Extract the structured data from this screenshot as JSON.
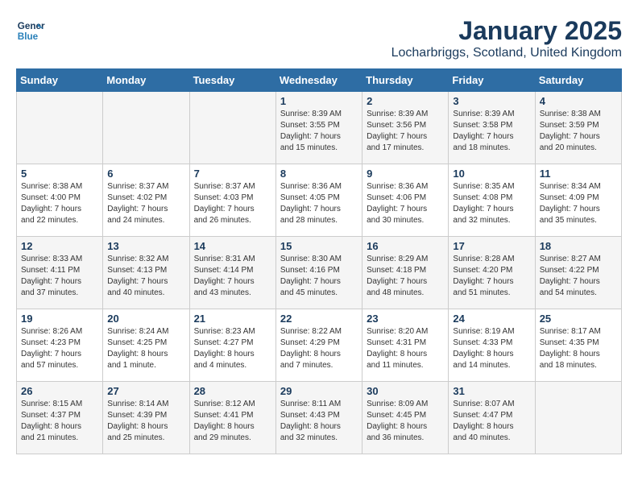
{
  "logo": {
    "line1": "General",
    "line2": "Blue"
  },
  "title": "January 2025",
  "location": "Locharbriggs, Scotland, United Kingdom",
  "weekdays": [
    "Sunday",
    "Monday",
    "Tuesday",
    "Wednesday",
    "Thursday",
    "Friday",
    "Saturday"
  ],
  "weeks": [
    [
      {
        "day": "",
        "lines": []
      },
      {
        "day": "",
        "lines": []
      },
      {
        "day": "",
        "lines": []
      },
      {
        "day": "1",
        "lines": [
          "Sunrise: 8:39 AM",
          "Sunset: 3:55 PM",
          "Daylight: 7 hours",
          "and 15 minutes."
        ]
      },
      {
        "day": "2",
        "lines": [
          "Sunrise: 8:39 AM",
          "Sunset: 3:56 PM",
          "Daylight: 7 hours",
          "and 17 minutes."
        ]
      },
      {
        "day": "3",
        "lines": [
          "Sunrise: 8:39 AM",
          "Sunset: 3:58 PM",
          "Daylight: 7 hours",
          "and 18 minutes."
        ]
      },
      {
        "day": "4",
        "lines": [
          "Sunrise: 8:38 AM",
          "Sunset: 3:59 PM",
          "Daylight: 7 hours",
          "and 20 minutes."
        ]
      }
    ],
    [
      {
        "day": "5",
        "lines": [
          "Sunrise: 8:38 AM",
          "Sunset: 4:00 PM",
          "Daylight: 7 hours",
          "and 22 minutes."
        ]
      },
      {
        "day": "6",
        "lines": [
          "Sunrise: 8:37 AM",
          "Sunset: 4:02 PM",
          "Daylight: 7 hours",
          "and 24 minutes."
        ]
      },
      {
        "day": "7",
        "lines": [
          "Sunrise: 8:37 AM",
          "Sunset: 4:03 PM",
          "Daylight: 7 hours",
          "and 26 minutes."
        ]
      },
      {
        "day": "8",
        "lines": [
          "Sunrise: 8:36 AM",
          "Sunset: 4:05 PM",
          "Daylight: 7 hours",
          "and 28 minutes."
        ]
      },
      {
        "day": "9",
        "lines": [
          "Sunrise: 8:36 AM",
          "Sunset: 4:06 PM",
          "Daylight: 7 hours",
          "and 30 minutes."
        ]
      },
      {
        "day": "10",
        "lines": [
          "Sunrise: 8:35 AM",
          "Sunset: 4:08 PM",
          "Daylight: 7 hours",
          "and 32 minutes."
        ]
      },
      {
        "day": "11",
        "lines": [
          "Sunrise: 8:34 AM",
          "Sunset: 4:09 PM",
          "Daylight: 7 hours",
          "and 35 minutes."
        ]
      }
    ],
    [
      {
        "day": "12",
        "lines": [
          "Sunrise: 8:33 AM",
          "Sunset: 4:11 PM",
          "Daylight: 7 hours",
          "and 37 minutes."
        ]
      },
      {
        "day": "13",
        "lines": [
          "Sunrise: 8:32 AM",
          "Sunset: 4:13 PM",
          "Daylight: 7 hours",
          "and 40 minutes."
        ]
      },
      {
        "day": "14",
        "lines": [
          "Sunrise: 8:31 AM",
          "Sunset: 4:14 PM",
          "Daylight: 7 hours",
          "and 43 minutes."
        ]
      },
      {
        "day": "15",
        "lines": [
          "Sunrise: 8:30 AM",
          "Sunset: 4:16 PM",
          "Daylight: 7 hours",
          "and 45 minutes."
        ]
      },
      {
        "day": "16",
        "lines": [
          "Sunrise: 8:29 AM",
          "Sunset: 4:18 PM",
          "Daylight: 7 hours",
          "and 48 minutes."
        ]
      },
      {
        "day": "17",
        "lines": [
          "Sunrise: 8:28 AM",
          "Sunset: 4:20 PM",
          "Daylight: 7 hours",
          "and 51 minutes."
        ]
      },
      {
        "day": "18",
        "lines": [
          "Sunrise: 8:27 AM",
          "Sunset: 4:22 PM",
          "Daylight: 7 hours",
          "and 54 minutes."
        ]
      }
    ],
    [
      {
        "day": "19",
        "lines": [
          "Sunrise: 8:26 AM",
          "Sunset: 4:23 PM",
          "Daylight: 7 hours",
          "and 57 minutes."
        ]
      },
      {
        "day": "20",
        "lines": [
          "Sunrise: 8:24 AM",
          "Sunset: 4:25 PM",
          "Daylight: 8 hours",
          "and 1 minute."
        ]
      },
      {
        "day": "21",
        "lines": [
          "Sunrise: 8:23 AM",
          "Sunset: 4:27 PM",
          "Daylight: 8 hours",
          "and 4 minutes."
        ]
      },
      {
        "day": "22",
        "lines": [
          "Sunrise: 8:22 AM",
          "Sunset: 4:29 PM",
          "Daylight: 8 hours",
          "and 7 minutes."
        ]
      },
      {
        "day": "23",
        "lines": [
          "Sunrise: 8:20 AM",
          "Sunset: 4:31 PM",
          "Daylight: 8 hours",
          "and 11 minutes."
        ]
      },
      {
        "day": "24",
        "lines": [
          "Sunrise: 8:19 AM",
          "Sunset: 4:33 PM",
          "Daylight: 8 hours",
          "and 14 minutes."
        ]
      },
      {
        "day": "25",
        "lines": [
          "Sunrise: 8:17 AM",
          "Sunset: 4:35 PM",
          "Daylight: 8 hours",
          "and 18 minutes."
        ]
      }
    ],
    [
      {
        "day": "26",
        "lines": [
          "Sunrise: 8:15 AM",
          "Sunset: 4:37 PM",
          "Daylight: 8 hours",
          "and 21 minutes."
        ]
      },
      {
        "day": "27",
        "lines": [
          "Sunrise: 8:14 AM",
          "Sunset: 4:39 PM",
          "Daylight: 8 hours",
          "and 25 minutes."
        ]
      },
      {
        "day": "28",
        "lines": [
          "Sunrise: 8:12 AM",
          "Sunset: 4:41 PM",
          "Daylight: 8 hours",
          "and 29 minutes."
        ]
      },
      {
        "day": "29",
        "lines": [
          "Sunrise: 8:11 AM",
          "Sunset: 4:43 PM",
          "Daylight: 8 hours",
          "and 32 minutes."
        ]
      },
      {
        "day": "30",
        "lines": [
          "Sunrise: 8:09 AM",
          "Sunset: 4:45 PM",
          "Daylight: 8 hours",
          "and 36 minutes."
        ]
      },
      {
        "day": "31",
        "lines": [
          "Sunrise: 8:07 AM",
          "Sunset: 4:47 PM",
          "Daylight: 8 hours",
          "and 40 minutes."
        ]
      },
      {
        "day": "",
        "lines": []
      }
    ]
  ]
}
